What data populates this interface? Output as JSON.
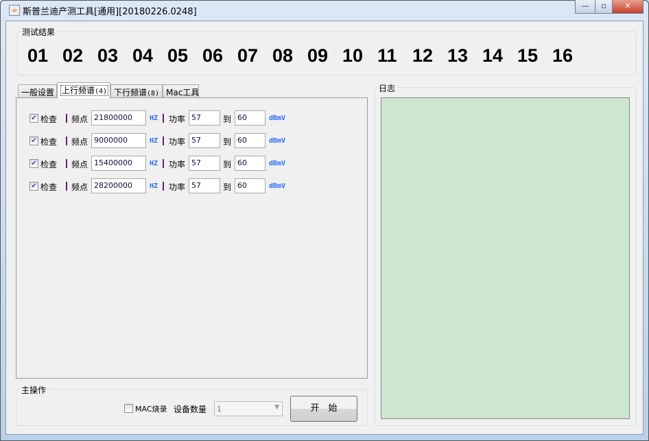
{
  "window": {
    "title": "斯普兰迪产测工具[通用][20180226.0248]",
    "minimize": "—",
    "maximize": "▫",
    "close": "✕"
  },
  "results": {
    "label": "测试结果",
    "items": [
      "01",
      "02",
      "03",
      "04",
      "05",
      "06",
      "07",
      "08",
      "09",
      "10",
      "11",
      "12",
      "13",
      "14",
      "15",
      "16"
    ]
  },
  "tabs": [
    {
      "label": "一般设置"
    },
    {
      "label": "上行频谱",
      "count": "(4)"
    },
    {
      "label": "下行频谱",
      "count": "(8)"
    },
    {
      "label": "Mac工具"
    }
  ],
  "rows": [
    {
      "check": "检查",
      "checked": true,
      "freq_label": "频点",
      "freq": "21800000",
      "hz": "HZ",
      "power_label": "功率",
      "min": "57",
      "to": "到",
      "max": "60",
      "unit": "dBmV"
    },
    {
      "check": "检查",
      "checked": true,
      "freq_label": "频点",
      "freq": "9000000",
      "hz": "HZ",
      "power_label": "功率",
      "min": "57",
      "to": "到",
      "max": "60",
      "unit": "dBmV"
    },
    {
      "check": "检查",
      "checked": true,
      "freq_label": "频点",
      "freq": "15400000",
      "hz": "HZ",
      "power_label": "功率",
      "min": "57",
      "to": "到",
      "max": "60",
      "unit": "dBmV"
    },
    {
      "check": "检查",
      "checked": true,
      "freq_label": "频点",
      "freq": "28200000",
      "hz": "HZ",
      "power_label": "功率",
      "min": "57",
      "to": "到",
      "max": "60",
      "unit": "dBmV"
    }
  ],
  "log": {
    "label": "日志"
  },
  "main": {
    "label": "主操作",
    "mac_label": "MAC烧录",
    "mac_checked": false,
    "count_label": "设备数量",
    "count_value": "1",
    "start": "开　始"
  },
  "colors": {
    "log_bg": "#cde7cf",
    "unit_blue": "#2a6df0"
  }
}
